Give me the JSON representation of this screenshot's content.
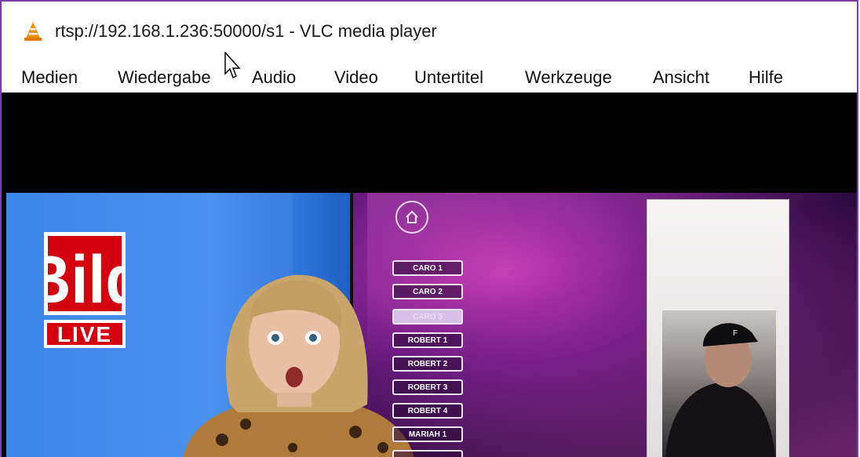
{
  "window": {
    "title": "rtsp://192.168.1.236:50000/s1 - VLC media player",
    "accent_color": "#7a3fa8"
  },
  "icons": {
    "app": "vlc-cone-icon",
    "cursor": "mouse-pointer-icon",
    "home": "home-icon"
  },
  "menu": {
    "items": [
      "Medien",
      "Wiedergabe",
      "Audio",
      "Video",
      "Untertitel",
      "Werkzeuge",
      "Ansicht",
      "Hilfe"
    ]
  },
  "video": {
    "logo": {
      "line1": "Bild",
      "line2": "LIVE"
    },
    "playlist": [
      "CARO 1",
      "CARO 2",
      "CARO 3",
      "ROBERT 1",
      "ROBERT 2",
      "ROBERT 3",
      "ROBERT 4",
      "MARIAH 1"
    ],
    "active_index": 2
  }
}
